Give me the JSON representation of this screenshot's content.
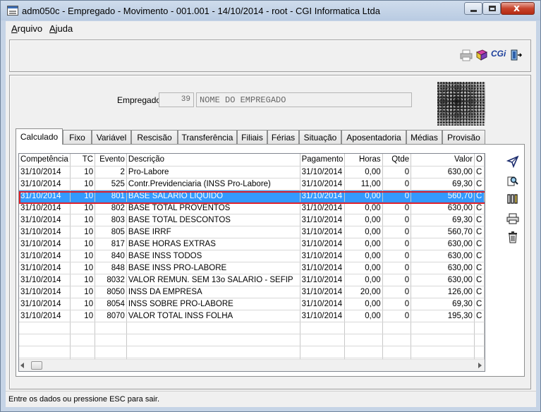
{
  "window": {
    "title": "adm050c - Empregado - Movimento - 001.001 - 14/10/2014 - root - CGI Informatica Ltda",
    "close_glyph": "x"
  },
  "menu": [
    {
      "label": "Arquivo",
      "accel": "A",
      "rest": "rquivo"
    },
    {
      "label": "Ajuda",
      "accel": "A",
      "rest": "juda"
    }
  ],
  "toolbar": {
    "icons": [
      "printer-icon",
      "book-icon",
      "cgi-logo-icon",
      "exit-door-icon"
    ],
    "cgi_text": "CGi"
  },
  "employee": {
    "label": "Empregado:",
    "code": "39",
    "name": "NOME DO EMPREGADO"
  },
  "tabs": [
    "Calculado",
    "Fixo",
    "Variável",
    "Rescisão",
    "Transferência",
    "Filiais",
    "Férias",
    "Situação",
    "Aposentadoria",
    "Médias",
    "Provisão"
  ],
  "active_tab": "Calculado",
  "grid": {
    "columns": [
      "Competência",
      "TC",
      "Evento",
      "Descrição",
      "Pagamento",
      "Horas",
      "Qtde",
      "Valor",
      "O"
    ],
    "rows": [
      [
        "31/10/2014",
        "10",
        "2",
        "Pro-Labore",
        "31/10/2014",
        "0,00",
        "0",
        "630,00",
        "C"
      ],
      [
        "31/10/2014",
        "10",
        "525",
        "Contr.Previdenciaria (INSS Pro-Labore)",
        "31/10/2014",
        "11,00",
        "0",
        "69,30",
        "C"
      ],
      [
        "31/10/2014",
        "10",
        "801",
        "BASE SALARIO LIQUIDO",
        "31/10/2014",
        "0,00",
        "0",
        "560,70",
        "C"
      ],
      [
        "31/10/2014",
        "10",
        "802",
        "BASE TOTAL PROVENTOS",
        "31/10/2014",
        "0,00",
        "0",
        "630,00",
        "C"
      ],
      [
        "31/10/2014",
        "10",
        "803",
        "BASE TOTAL DESCONTOS",
        "31/10/2014",
        "0,00",
        "0",
        "69,30",
        "C"
      ],
      [
        "31/10/2014",
        "10",
        "805",
        "BASE IRRF",
        "31/10/2014",
        "0,00",
        "0",
        "560,70",
        "C"
      ],
      [
        "31/10/2014",
        "10",
        "817",
        "BASE HORAS EXTRAS",
        "31/10/2014",
        "0,00",
        "0",
        "630,00",
        "C"
      ],
      [
        "31/10/2014",
        "10",
        "840",
        "BASE INSS TODOS",
        "31/10/2014",
        "0,00",
        "0",
        "630,00",
        "C"
      ],
      [
        "31/10/2014",
        "10",
        "848",
        "BASE INSS PRO-LABORE",
        "31/10/2014",
        "0,00",
        "0",
        "630,00",
        "C"
      ],
      [
        "31/10/2014",
        "10",
        "8032",
        "VALOR REMUN. SEM 13o SALARIO - SEFIP",
        "31/10/2014",
        "0,00",
        "0",
        "630,00",
        "C"
      ],
      [
        "31/10/2014",
        "10",
        "8050",
        "INSS DA EMPRESA",
        "31/10/2014",
        "20,00",
        "0",
        "126,00",
        "C"
      ],
      [
        "31/10/2014",
        "10",
        "8054",
        "INSS SOBRE PRO-LABORE",
        "31/10/2014",
        "0,00",
        "0",
        "69,30",
        "C"
      ],
      [
        "31/10/2014",
        "10",
        "8070",
        "VALOR TOTAL INSS FOLHA",
        "31/10/2014",
        "0,00",
        "0",
        "195,30",
        "C"
      ]
    ],
    "selected_row": 2,
    "empty_rows": 4
  },
  "side_actions": [
    "filter-icon",
    "search-document-icon",
    "columns-icon",
    "print-icon",
    "trash-icon"
  ],
  "colors": {
    "selection": "#3399ff",
    "selection_outline": "#e0202a"
  },
  "status": {
    "text": "Entre os dados ou pressione ESC para sair."
  }
}
